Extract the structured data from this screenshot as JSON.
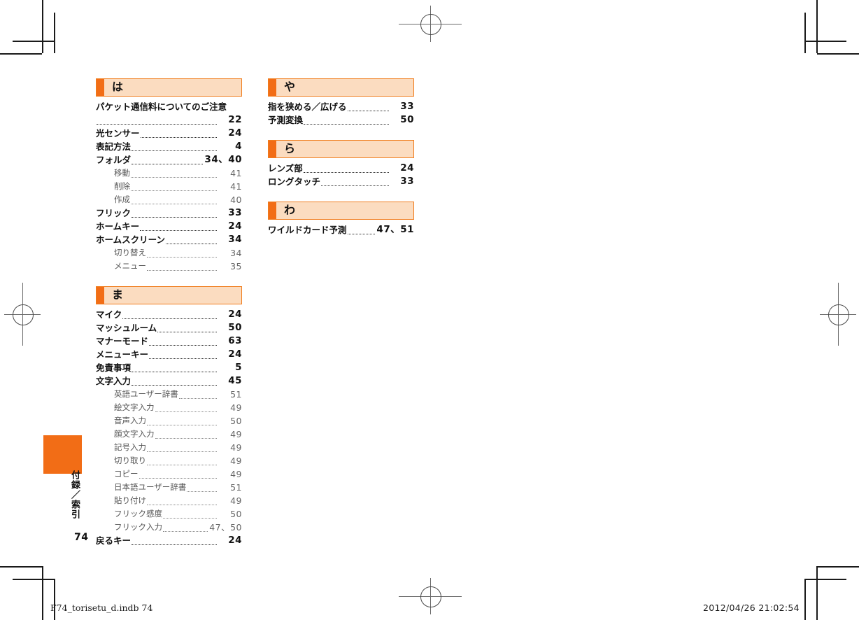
{
  "document": {
    "folio": "74",
    "thumb_label": "付録／索引",
    "footer_left": "F74_torisetu_d.indb   74",
    "footer_right": "2012/04/26   21:02:54",
    "accent_color": "#f26d16",
    "band_fill_color": "#fbdcc0"
  },
  "columns": [
    {
      "name": "left-column",
      "sections": [
        {
          "kana": "は",
          "entries": [
            {
              "level": 1,
              "text": "パケット通信料についてのご注意",
              "page": "22",
              "wrapped": true
            },
            {
              "level": 1,
              "text": "光センサー",
              "page": "24"
            },
            {
              "level": 1,
              "text": "表記方法",
              "page": "4"
            },
            {
              "level": 1,
              "text": "フォルダ",
              "page": "34、40"
            },
            {
              "level": 2,
              "text": "移動",
              "page": "41"
            },
            {
              "level": 2,
              "text": "削除",
              "page": "41"
            },
            {
              "level": 2,
              "text": "作成",
              "page": "40"
            },
            {
              "level": 1,
              "text": "フリック",
              "page": "33"
            },
            {
              "level": 1,
              "text": "ホームキー",
              "page": "24"
            },
            {
              "level": 1,
              "text": "ホームスクリーン",
              "page": "34"
            },
            {
              "level": 2,
              "text": "切り替え",
              "page": "34"
            },
            {
              "level": 2,
              "text": "メニュー",
              "page": "35"
            }
          ]
        },
        {
          "kana": "ま",
          "entries": [
            {
              "level": 1,
              "text": "マイク",
              "page": "24"
            },
            {
              "level": 1,
              "text": "マッシュルーム",
              "page": "50"
            },
            {
              "level": 1,
              "text": "マナーモード",
              "page": "63"
            },
            {
              "level": 1,
              "text": "メニューキー",
              "page": "24"
            },
            {
              "level": 1,
              "text": "免責事項",
              "page": "5"
            },
            {
              "level": 1,
              "text": "文字入力",
              "page": "45"
            },
            {
              "level": 2,
              "text": "英語ユーザー辞書",
              "page": "51"
            },
            {
              "level": 2,
              "text": "絵文字入力",
              "page": "49"
            },
            {
              "level": 2,
              "text": "音声入力",
              "page": "50"
            },
            {
              "level": 2,
              "text": "顔文字入力",
              "page": "49"
            },
            {
              "level": 2,
              "text": "記号入力",
              "page": "49"
            },
            {
              "level": 2,
              "text": "切り取り",
              "page": "49"
            },
            {
              "level": 2,
              "text": "コピー",
              "page": "49"
            },
            {
              "level": 2,
              "text": "日本語ユーザー辞書",
              "page": "51"
            },
            {
              "level": 2,
              "text": "貼り付け",
              "page": "49"
            },
            {
              "level": 2,
              "text": "フリック感度",
              "page": "50"
            },
            {
              "level": 2,
              "text": "フリック入力",
              "page": "47、50"
            },
            {
              "level": 1,
              "text": "戻るキー",
              "page": "24"
            }
          ]
        }
      ]
    },
    {
      "name": "right-column",
      "sections": [
        {
          "kana": "や",
          "entries": [
            {
              "level": 1,
              "text": "指を狭める／広げる",
              "page": "33"
            },
            {
              "level": 1,
              "text": "予測変換",
              "page": "50"
            }
          ]
        },
        {
          "kana": "ら",
          "entries": [
            {
              "level": 1,
              "text": "レンズ部",
              "page": "24"
            },
            {
              "level": 1,
              "text": "ロングタッチ",
              "page": "33"
            }
          ]
        },
        {
          "kana": "わ",
          "entries": [
            {
              "level": 1,
              "text": "ワイルドカード予測",
              "page": "47、51"
            }
          ]
        }
      ]
    }
  ]
}
